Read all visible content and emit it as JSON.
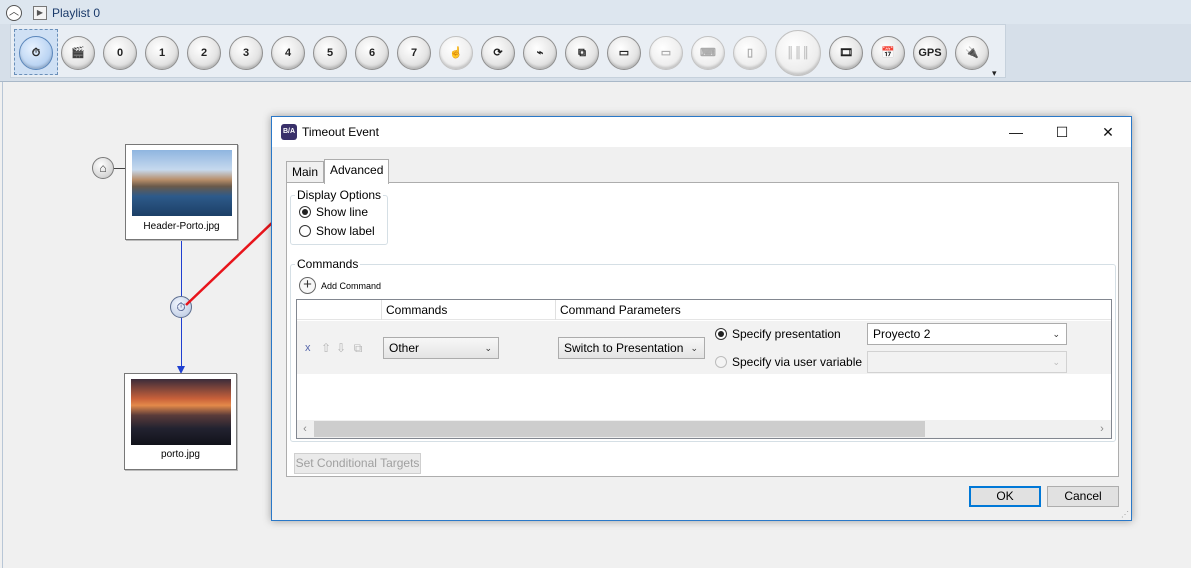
{
  "playlist": {
    "title": "Playlist 0",
    "collapse_icon": "chevron-up-icon",
    "play_icon": "play-icon"
  },
  "toolbar": {
    "items": [
      {
        "name": "timeout-event",
        "icon": "stopwatch-icon",
        "glyph": "⏱",
        "active": true
      },
      {
        "name": "media-end-event",
        "icon": "clapperboard-icon",
        "glyph": "🎬"
      },
      {
        "name": "keypress-0",
        "icon": "key-0-icon",
        "glyph": "0"
      },
      {
        "name": "keypress-1",
        "icon": "key-1-icon",
        "glyph": "1"
      },
      {
        "name": "keypress-2",
        "icon": "key-2-icon",
        "glyph": "2"
      },
      {
        "name": "keypress-3",
        "icon": "key-3-icon",
        "glyph": "3"
      },
      {
        "name": "keypress-4",
        "icon": "key-4-icon",
        "glyph": "4"
      },
      {
        "name": "keypress-5",
        "icon": "key-5-icon",
        "glyph": "5"
      },
      {
        "name": "keypress-6",
        "icon": "key-6-icon",
        "glyph": "6"
      },
      {
        "name": "keypress-7",
        "icon": "key-7-icon",
        "glyph": "7"
      },
      {
        "name": "touch-event",
        "icon": "touch-hand-icon",
        "glyph": "☝",
        "disabled": true
      },
      {
        "name": "synchronize-event",
        "icon": "sync-icon",
        "glyph": "⟳"
      },
      {
        "name": "usb-event",
        "icon": "usb-icon",
        "glyph": "⌁"
      },
      {
        "name": "zone-message-event",
        "icon": "zones-icon",
        "glyph": "⧉"
      },
      {
        "name": "monitor-event",
        "icon": "monitor-icon",
        "glyph": "▭"
      },
      {
        "name": "serial-event",
        "icon": "serial-port-icon",
        "glyph": "▭",
        "disabled": true
      },
      {
        "name": "keyboard-event",
        "icon": "keyboard-icon",
        "glyph": "⌨",
        "disabled": true
      },
      {
        "name": "remote-event",
        "icon": "remote-control-icon",
        "glyph": "▯",
        "disabled": true
      },
      {
        "name": "barcode-event",
        "icon": "barcode-icon",
        "glyph": "║║║",
        "big": true,
        "disabled": true
      },
      {
        "name": "media-list-timer-event",
        "icon": "film-clock-icon",
        "glyph": "🎞"
      },
      {
        "name": "time-clock-event",
        "icon": "calendar-clock-icon",
        "glyph": "📅"
      },
      {
        "name": "gps-event",
        "icon": "gps-icon",
        "glyph": "GPS"
      },
      {
        "name": "plugin-event",
        "icon": "plug-icon",
        "glyph": "🔌"
      }
    ],
    "more_glyph": "▾"
  },
  "canvas": {
    "home_icon": "home-icon",
    "nodes": [
      {
        "label": "Header-Porto.jpg"
      },
      {
        "label": "porto.jpg"
      }
    ],
    "timer_icon": "stopwatch-icon"
  },
  "dialog": {
    "title": "Timeout Event",
    "app_icon_text": "B/A",
    "controls": {
      "minimize": "—",
      "maximize": "☐",
      "close": "✕"
    },
    "tabs": [
      {
        "label": "Main"
      },
      {
        "label": "Advanced"
      }
    ],
    "display_options": {
      "label": "Display Options",
      "options": [
        {
          "label": "Show line",
          "checked": true
        },
        {
          "label": "Show label",
          "checked": false
        }
      ]
    },
    "commands": {
      "label": "Commands",
      "add_label": "Add Command",
      "columns": [
        "Commands",
        "Command Parameters"
      ],
      "rows": [
        {
          "remove": "x",
          "command": "Other",
          "parameter": "Switch to Presentation",
          "specify_presentation": {
            "label": "Specify presentation",
            "checked": true,
            "value": "Proyecto 2"
          },
          "specify_variable": {
            "label": "Specify via user variable",
            "checked": false,
            "value": ""
          }
        }
      ]
    },
    "set_conditional_targets": "Set Conditional Targets",
    "ok": "OK",
    "cancel": "Cancel"
  }
}
